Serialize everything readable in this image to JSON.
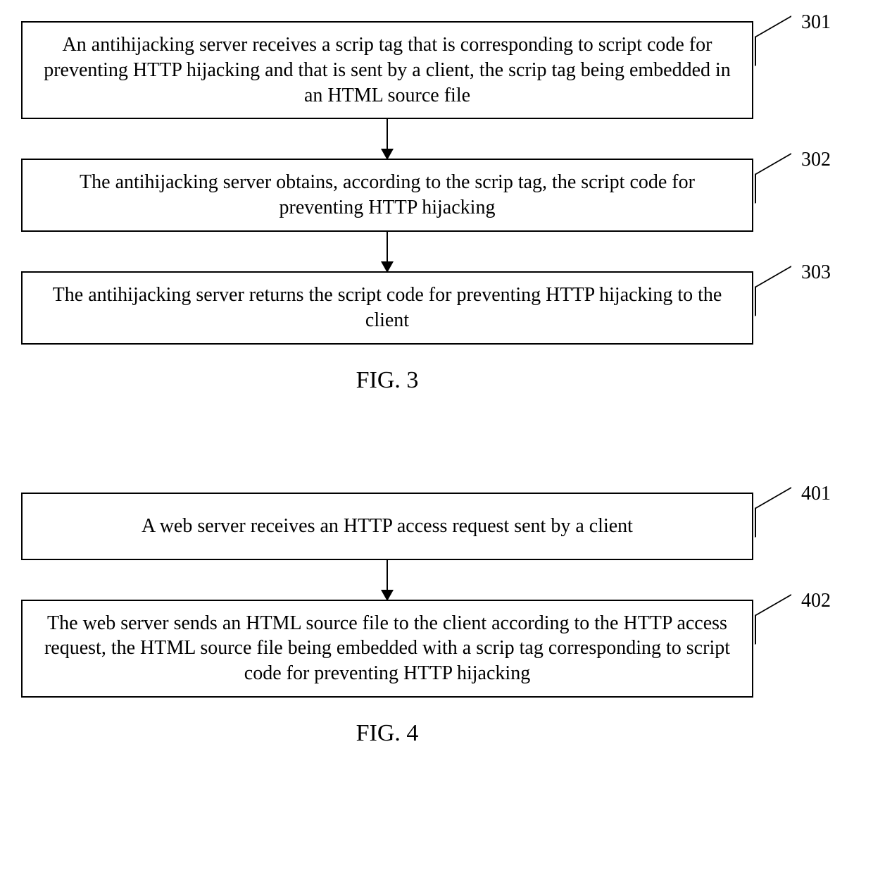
{
  "fig3": {
    "caption": "FIG. 3",
    "steps": [
      {
        "ref": "301",
        "text": "An antihijacking server receives a scrip tag that is corresponding to script code for preventing HTTP hijacking and that is sent by a client, the scrip tag being embedded in an HTML source file"
      },
      {
        "ref": "302",
        "text": "The antihijacking server obtains, according to the scrip tag, the script code for preventing HTTP hijacking"
      },
      {
        "ref": "303",
        "text": "The antihijacking server returns the script code for preventing HTTP hijacking to the client"
      }
    ]
  },
  "fig4": {
    "caption": "FIG. 4",
    "steps": [
      {
        "ref": "401",
        "text": "A web server receives an HTTP access request sent by a client"
      },
      {
        "ref": "402",
        "text": "The web server sends an HTML source file to the client according to the HTTP access request, the HTML source file being embedded with a scrip tag corresponding to script code for preventing HTTP hijacking"
      }
    ]
  }
}
